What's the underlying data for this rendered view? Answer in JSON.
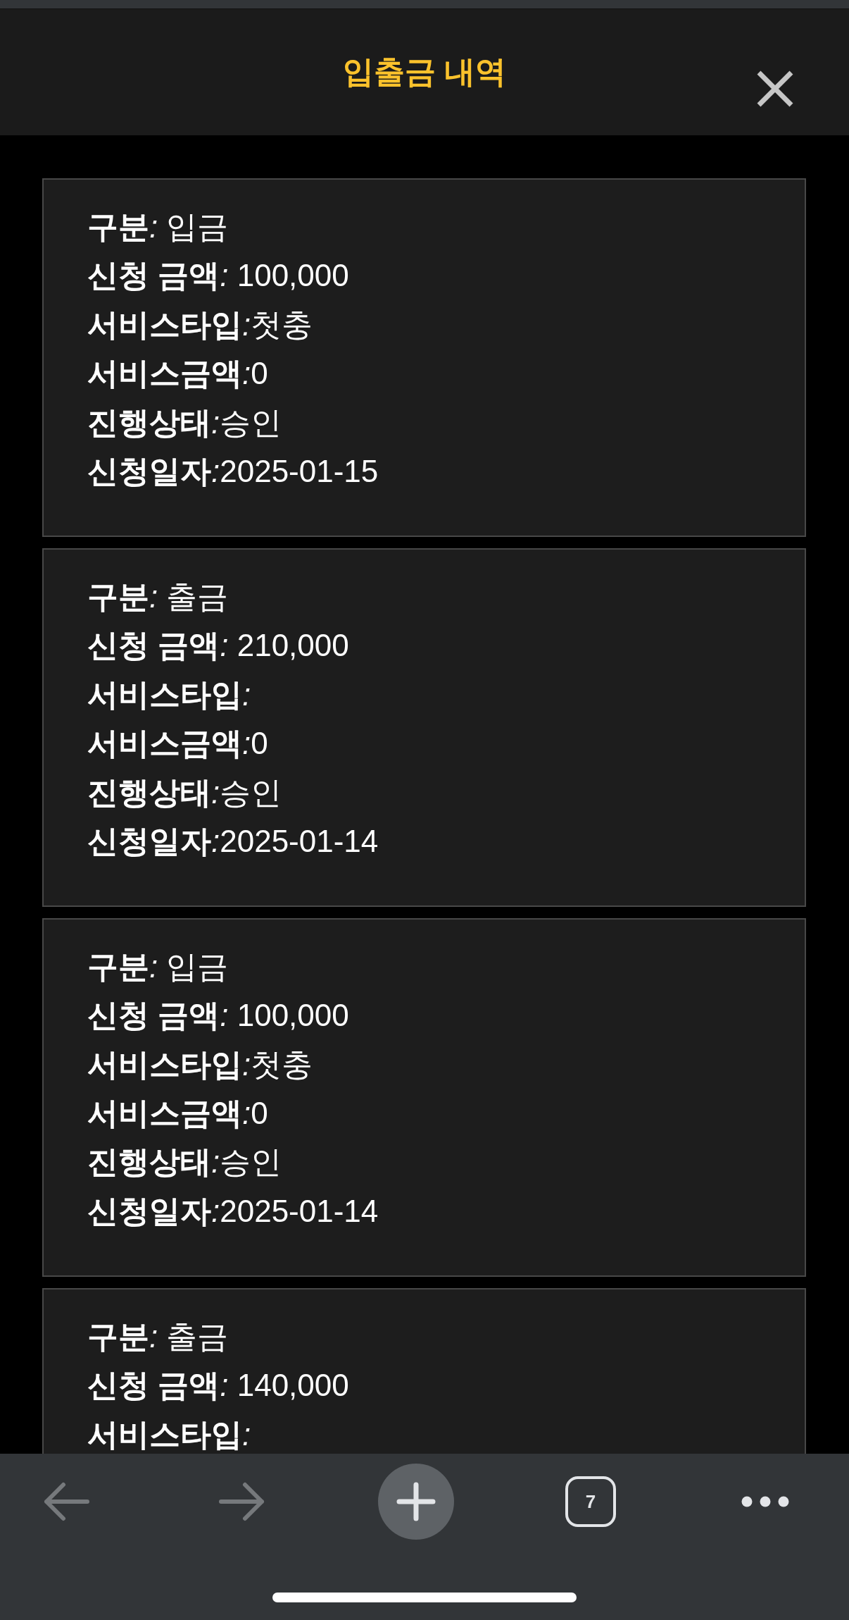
{
  "header": {
    "title": "입출금 내역"
  },
  "records": [
    {
      "fields": [
        {
          "label": "구분",
          "separator": ": ",
          "value": "입금"
        },
        {
          "label": "신청 금액",
          "separator": ": ",
          "value": "100,000"
        },
        {
          "label": "서비스타입",
          "separator": ":",
          "value": "첫충"
        },
        {
          "label": "서비스금액",
          "separator": ":",
          "value": "0"
        },
        {
          "label": "진행상태",
          "separator": ":",
          "value": "승인"
        },
        {
          "label": "신청일자",
          "separator": ":",
          "value": "2025-01-15"
        }
      ]
    },
    {
      "fields": [
        {
          "label": "구분",
          "separator": ": ",
          "value": "출금"
        },
        {
          "label": "신청 금액",
          "separator": ": ",
          "value": "210,000"
        },
        {
          "label": "서비스타입",
          "separator": ":"
        },
        {
          "label": "서비스금액",
          "separator": ":",
          "value": "0"
        },
        {
          "label": "진행상태",
          "separator": ":",
          "value": "승인"
        },
        {
          "label": "신청일자",
          "separator": ":",
          "value": "2025-01-14"
        }
      ]
    },
    {
      "fields": [
        {
          "label": "구분",
          "separator": ": ",
          "value": "입금"
        },
        {
          "label": "신청 금액",
          "separator": ": ",
          "value": "100,000"
        },
        {
          "label": "서비스타입",
          "separator": ":",
          "value": "첫충"
        },
        {
          "label": "서비스금액",
          "separator": ":",
          "value": "0"
        },
        {
          "label": "진행상태",
          "separator": ":",
          "value": "승인"
        },
        {
          "label": "신청일자",
          "separator": ":",
          "value": "2025-01-14"
        }
      ]
    },
    {
      "fields": [
        {
          "label": "구분",
          "separator": ": ",
          "value": "출금"
        },
        {
          "label": "신청 금액",
          "separator": ": ",
          "value": "140,000"
        },
        {
          "label": "서비스타입",
          "separator": ":"
        }
      ]
    }
  ],
  "toolbar": {
    "buttons": [
      {
        "kind": "back",
        "disabled": true
      },
      {
        "kind": "forward",
        "disabled": true
      },
      {
        "kind": "add",
        "disabled": false
      },
      {
        "kind": "tabs",
        "count": "7",
        "disabled": false
      },
      {
        "kind": "more",
        "disabled": false
      }
    ]
  }
}
